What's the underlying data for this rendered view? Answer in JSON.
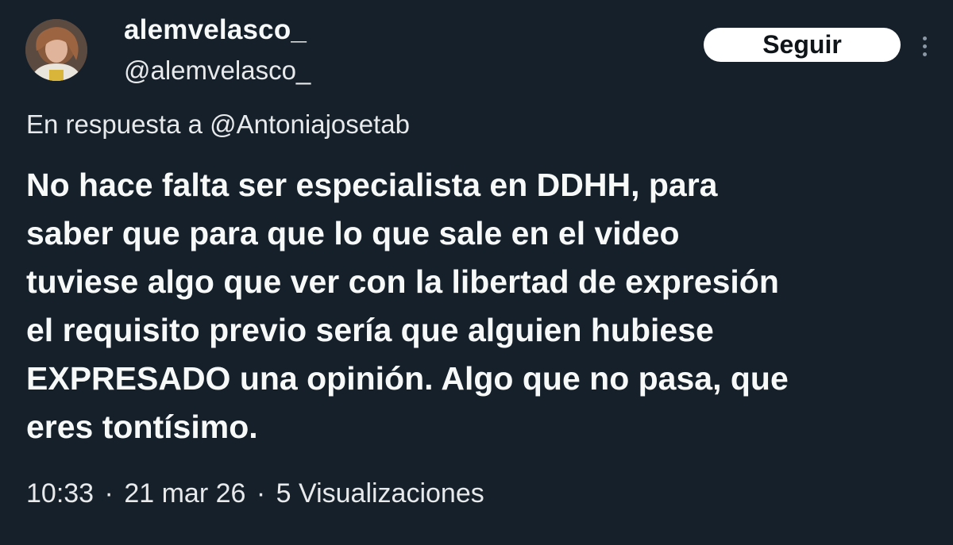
{
  "tweet": {
    "display_name": "alemvelasco_",
    "handle": "@alemvelasco_",
    "follow_label": "Seguir",
    "reply_to": "En respuesta a @Antoniajosetab",
    "text": "No hace falta ser especialista en DDHH, para\nsaber que para que lo que sale en el video\ntuviese algo que ver con la libertad de expresión\nel requisito previo sería que alguien hubiese\nEXPRESADO una opinión. Algo que no pasa, que\neres tontísimo.",
    "time": "10:33",
    "date": "21 mar 26",
    "views": "5 Visualizaciones",
    "separator": "·"
  },
  "icons": {
    "avatar": "user-avatar-photo",
    "more": "more-vertical-icon"
  },
  "colors": {
    "background": "#15202b",
    "text_primary": "#f7f9f9",
    "follow_button_bg": "#ffffff",
    "follow_button_text": "#0f1419",
    "icon_muted": "#8b98a5"
  }
}
